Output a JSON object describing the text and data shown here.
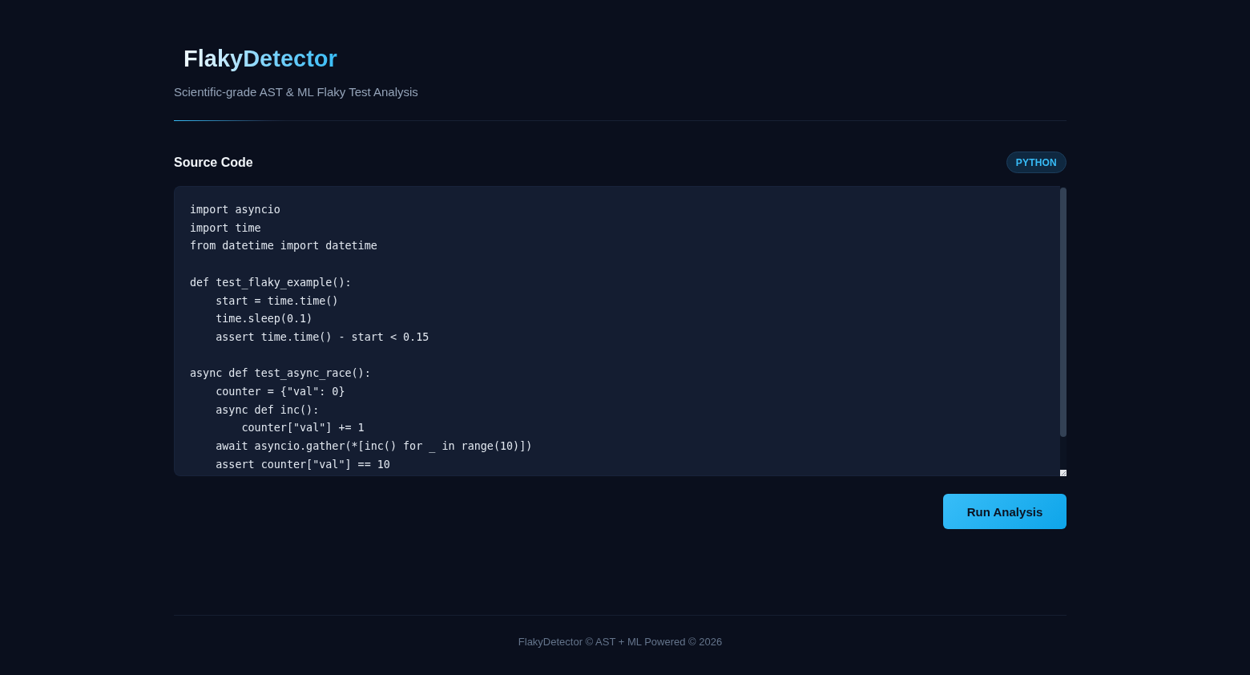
{
  "header": {
    "title": "FlakyDetector",
    "subtitle": "Scientific-grade AST & ML Flaky Test Analysis"
  },
  "editor": {
    "label": "Source Code",
    "language_badge": "PYTHON",
    "value": "import asyncio\nimport time\nfrom datetime import datetime\n\ndef test_flaky_example():\n    start = time.time()\n    time.sleep(0.1)\n    assert time.time() - start < 0.15\n\nasync def test_async_race():\n    counter = {\"val\": 0}\n    async def inc():\n        counter[\"val\"] += 1\n    await asyncio.gather(*[inc() for _ in range(10)])\n    assert counter[\"val\"] == 10"
  },
  "run_button": "Run Analysis",
  "footer": "FlakyDetector © AST + ML Powered © 2026"
}
